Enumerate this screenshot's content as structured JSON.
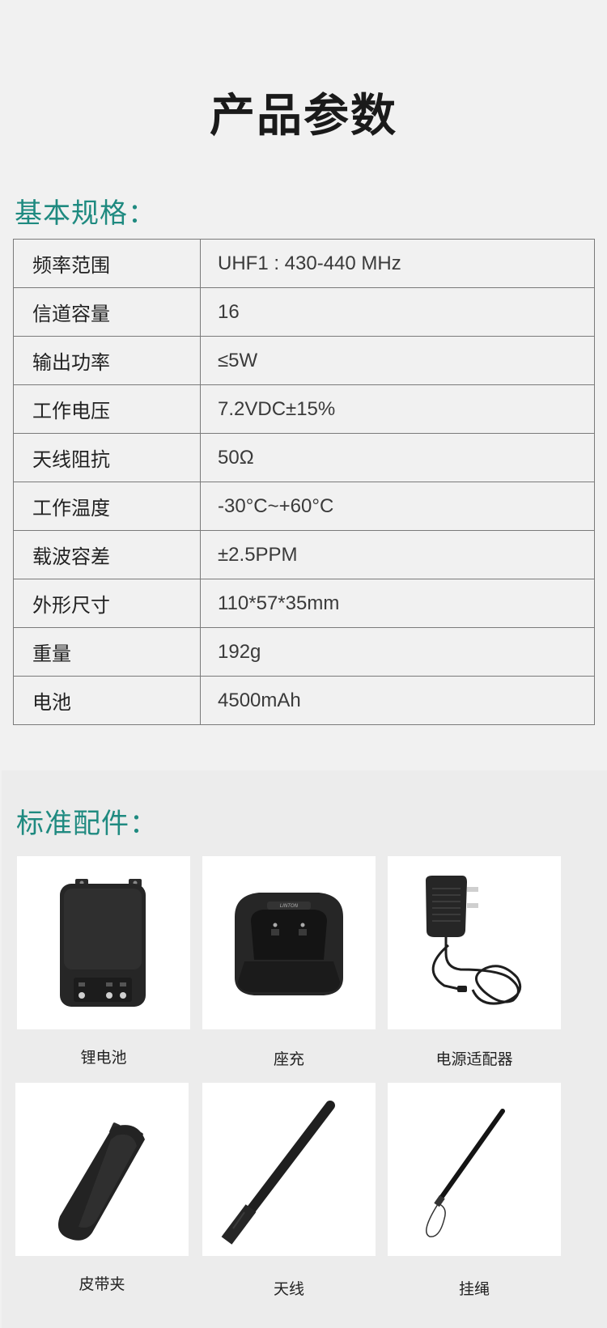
{
  "header": {
    "title": "产品参数"
  },
  "specs": {
    "section_title": "基本规格：",
    "rows": [
      {
        "key": "频率范围",
        "value": "UHF1 : 430-440 MHz"
      },
      {
        "key": "信道容量",
        "value": "16"
      },
      {
        "key": "输出功率",
        "value": "≤5W"
      },
      {
        "key": "工作电压",
        "value": "7.2VDC±15%"
      },
      {
        "key": "天线阻抗",
        "value": "50Ω"
      },
      {
        "key": "工作温度",
        "value": "-30°C~+60°C"
      },
      {
        "key": "载波容差",
        "value": "±2.5PPM"
      },
      {
        "key": "外形尺寸",
        "value": "110*57*35mm"
      },
      {
        "key": "重量",
        "value": "192g"
      },
      {
        "key": "电池",
        "value": "4500mAh"
      }
    ]
  },
  "accessories": {
    "section_title": "标准配件：",
    "items": [
      {
        "label": "锂电池",
        "icon": "battery-icon"
      },
      {
        "label": "座充",
        "icon": "charger-cradle-icon"
      },
      {
        "label": "电源适配器",
        "icon": "power-adapter-icon"
      },
      {
        "label": "皮带夹",
        "icon": "belt-clip-icon"
      },
      {
        "label": "天线",
        "icon": "antenna-icon"
      },
      {
        "label": "挂绳",
        "icon": "lanyard-icon"
      }
    ],
    "cradle_brand": "LINTON"
  },
  "colors": {
    "accent": "#1f8a80",
    "background": "#f1f1f1",
    "table_border": "#7a7a7a"
  }
}
